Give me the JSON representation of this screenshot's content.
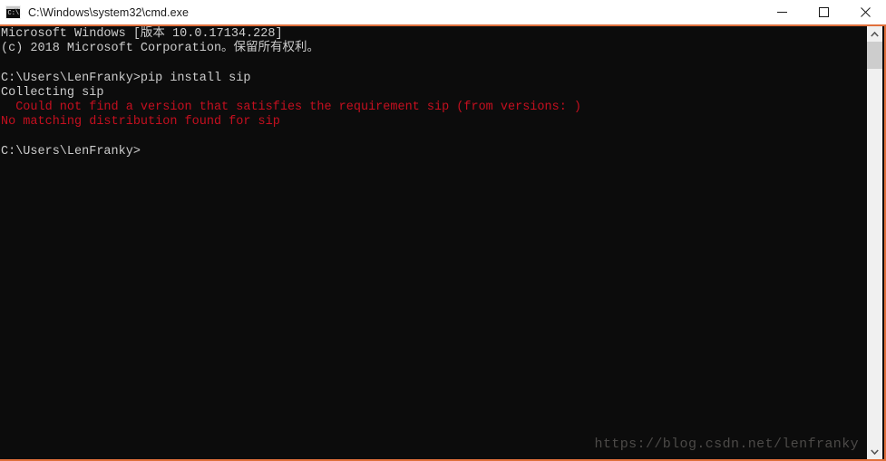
{
  "window": {
    "title": "C:\\Windows\\system32\\cmd.exe",
    "icon": "cmd-console-icon",
    "icon_prompt": "C:\\.",
    "controls": {
      "minimize_label": "Minimize",
      "maximize_label": "Maximize",
      "close_label": "Close"
    },
    "border_color": "#e0703c"
  },
  "console": {
    "background": "#0c0c0c",
    "foreground": "#cccccc",
    "error_color": "#c50f1f",
    "lines": [
      {
        "text": "Microsoft Windows [版本 10.0.17134.228]",
        "color": "white"
      },
      {
        "text": "(c) 2018 Microsoft Corporation。保留所有权利。",
        "color": "white"
      },
      {
        "text": "",
        "color": "white"
      },
      {
        "text": "C:\\Users\\LenFranky>pip install sip",
        "color": "white"
      },
      {
        "text": "Collecting sip",
        "color": "white"
      },
      {
        "text": "  Could not find a version that satisfies the requirement sip (from versions: )",
        "color": "red"
      },
      {
        "text": "No matching distribution found for sip",
        "color": "red"
      },
      {
        "text": "",
        "color": "white"
      },
      {
        "text": "C:\\Users\\LenFranky>",
        "color": "white"
      }
    ],
    "watermark": "https://blog.csdn.net/lenfranky"
  },
  "scrollbar": {
    "up_arrow": "chevron-up-icon",
    "down_arrow": "chevron-down-icon",
    "thumb_label": "scrollbar-thumb"
  }
}
